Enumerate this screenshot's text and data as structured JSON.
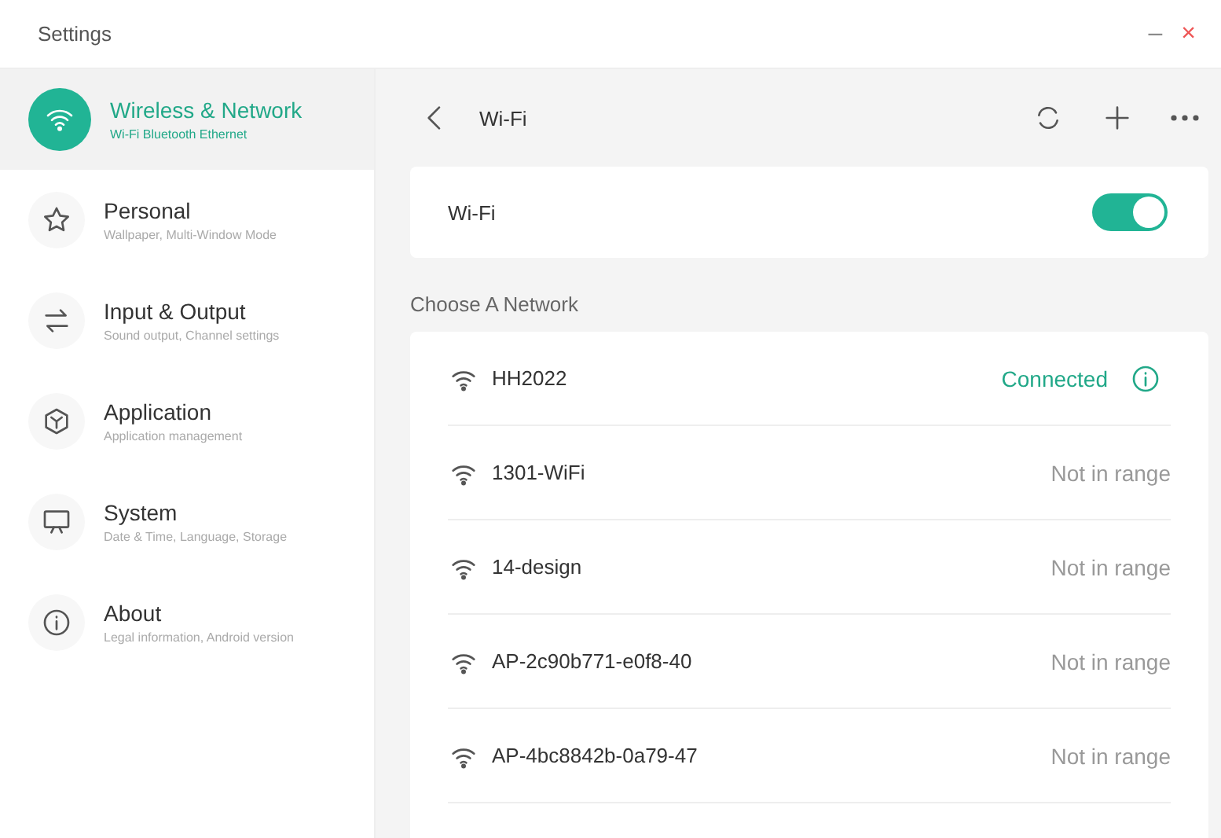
{
  "window": {
    "title": "Settings",
    "minimize": "–",
    "close": "×"
  },
  "sidebar": {
    "items": [
      {
        "label": "Wireless & Network",
        "subtitle": "Wi-Fi Bluetooth Ethernet",
        "selected": true
      },
      {
        "label": "Personal",
        "subtitle": "Wallpaper, Multi-Window Mode",
        "selected": false
      },
      {
        "label": "Input & Output",
        "subtitle": "Sound output, Channel settings",
        "selected": false
      },
      {
        "label": "Application",
        "subtitle": "Application management",
        "selected": false
      },
      {
        "label": "System",
        "subtitle": "Date & Time, Language, Storage",
        "selected": false
      },
      {
        "label": "About",
        "subtitle": "Legal information, Android version",
        "selected": false
      }
    ]
  },
  "header": {
    "title": "Wi-Fi"
  },
  "wifi_toggle": {
    "label": "Wi-Fi",
    "on": true
  },
  "section_title": "Choose A Network",
  "networks": [
    {
      "name": "HH2022",
      "status": "Connected",
      "connected": true
    },
    {
      "name": "1301-WiFi",
      "status": "Not in range",
      "connected": false
    },
    {
      "name": "14-design",
      "status": "Not in range",
      "connected": false
    },
    {
      "name": "AP-2c90b771-e0f8-40",
      "status": "Not in range",
      "connected": false
    },
    {
      "name": "AP-4bc8842b-0a79-47",
      "status": "Not in range",
      "connected": false
    }
  ]
}
